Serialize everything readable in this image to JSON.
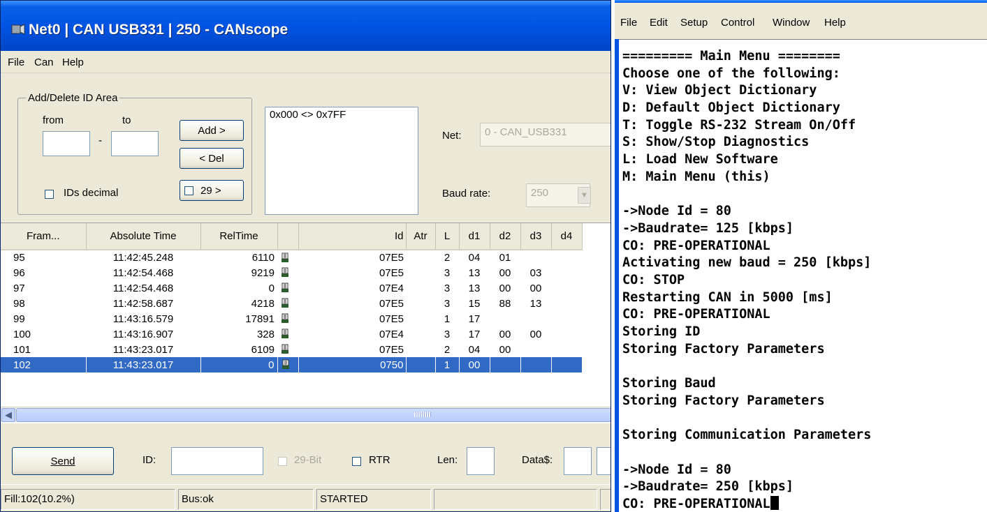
{
  "canscope": {
    "title": "Net0 | CAN USB331 | 250 - CANscope",
    "menu": [
      "File",
      "Can",
      "Help"
    ],
    "id_area": {
      "legend": "Add/Delete ID Area",
      "from_label": "from",
      "to_label": "to",
      "add_button": "Add >",
      "del_button": "< Del",
      "bit29_button": "29 >",
      "ids_decimal_label": "IDs decimal",
      "ids_decimal_checked": false,
      "range_list": [
        "0x000 <> 0x7FF"
      ]
    },
    "net_label": "Net:",
    "net_value": "0 - CAN_USB331",
    "baud_label": "Baud rate:",
    "baud_value": "250",
    "table": {
      "headers": [
        "Fram...",
        "Absolute Time",
        "RelTime",
        "",
        "Id",
        "Atr",
        "L",
        "d1",
        "d2",
        "d3",
        "d4"
      ],
      "rows": [
        {
          "frame": "95",
          "abs": "11:42:45.248",
          "rel": "6110",
          "id": "07E5",
          "atr": "",
          "len": "2",
          "d1": "04",
          "d2": "01",
          "d3": "",
          "d4": ""
        },
        {
          "frame": "96",
          "abs": "11:42:54.468",
          "rel": "9219",
          "id": "07E5",
          "atr": "",
          "len": "3",
          "d1": "13",
          "d2": "00",
          "d3": "03",
          "d4": ""
        },
        {
          "frame": "97",
          "abs": "11:42:54.468",
          "rel": "0",
          "id": "07E4",
          "atr": "",
          "len": "3",
          "d1": "13",
          "d2": "00",
          "d3": "00",
          "d4": ""
        },
        {
          "frame": "98",
          "abs": "11:42:58.687",
          "rel": "4218",
          "id": "07E5",
          "atr": "",
          "len": "3",
          "d1": "15",
          "d2": "88",
          "d3": "13",
          "d4": ""
        },
        {
          "frame": "99",
          "abs": "11:43:16.579",
          "rel": "17891",
          "id": "07E5",
          "atr": "",
          "len": "1",
          "d1": "17",
          "d2": "",
          "d3": "",
          "d4": ""
        },
        {
          "frame": "100",
          "abs": "11:43:16.907",
          "rel": "328",
          "id": "07E4",
          "atr": "",
          "len": "3",
          "d1": "17",
          "d2": "00",
          "d3": "00",
          "d4": ""
        },
        {
          "frame": "101",
          "abs": "11:43:23.017",
          "rel": "6109",
          "id": "07E5",
          "atr": "",
          "len": "2",
          "d1": "04",
          "d2": "00",
          "d3": "",
          "d4": ""
        },
        {
          "frame": "102",
          "abs": "11:43:23.017",
          "rel": "0",
          "id": "0750",
          "atr": "",
          "len": "1",
          "d1": "00",
          "d2": "",
          "d3": "",
          "d4": ""
        }
      ],
      "selected_row": 7
    },
    "send_bar": {
      "send_button": "Send",
      "id_label": "ID:",
      "bit29_label": "29-Bit",
      "rtr_label": "RTR",
      "len_label": "Len:",
      "data_label": "Data$:"
    },
    "status": {
      "fill": "Fill:102(10.2%)",
      "bus": "Bus:ok",
      "state": "STARTED"
    },
    "colors": {
      "selection": "#316ac5",
      "titlebar": "#0054e3",
      "chrome": "#ece9d8"
    }
  },
  "terminal": {
    "menu": [
      "File",
      "Edit",
      "Setup",
      "Control",
      "Window",
      "Help"
    ],
    "lines": [
      "========= Main Menu ========",
      "Choose one of the following:",
      "V: View Object Dictionary",
      "D: Default Object Dictionary",
      "T: Toggle RS-232 Stream On/Off",
      "S: Show/Stop Diagnostics",
      "L: Load New Software",
      "M: Main Menu (this)",
      "",
      "->Node Id = 80",
      "->Baudrate= 125 [kbps]",
      "CO: PRE-OPERATIONAL",
      "Activating new baud = 250 [kbps]",
      "CO: STOP",
      "Restarting CAN in 5000 [ms]",
      "CO: PRE-OPERATIONAL",
      "Storing ID",
      "Storing Factory Parameters",
      "",
      "Storing Baud",
      "Storing Factory Parameters",
      "",
      "Storing Communication Parameters",
      "",
      "->Node Id = 80",
      "->Baudrate= 250 [kbps]",
      "CO: PRE-OPERATIONAL"
    ]
  }
}
